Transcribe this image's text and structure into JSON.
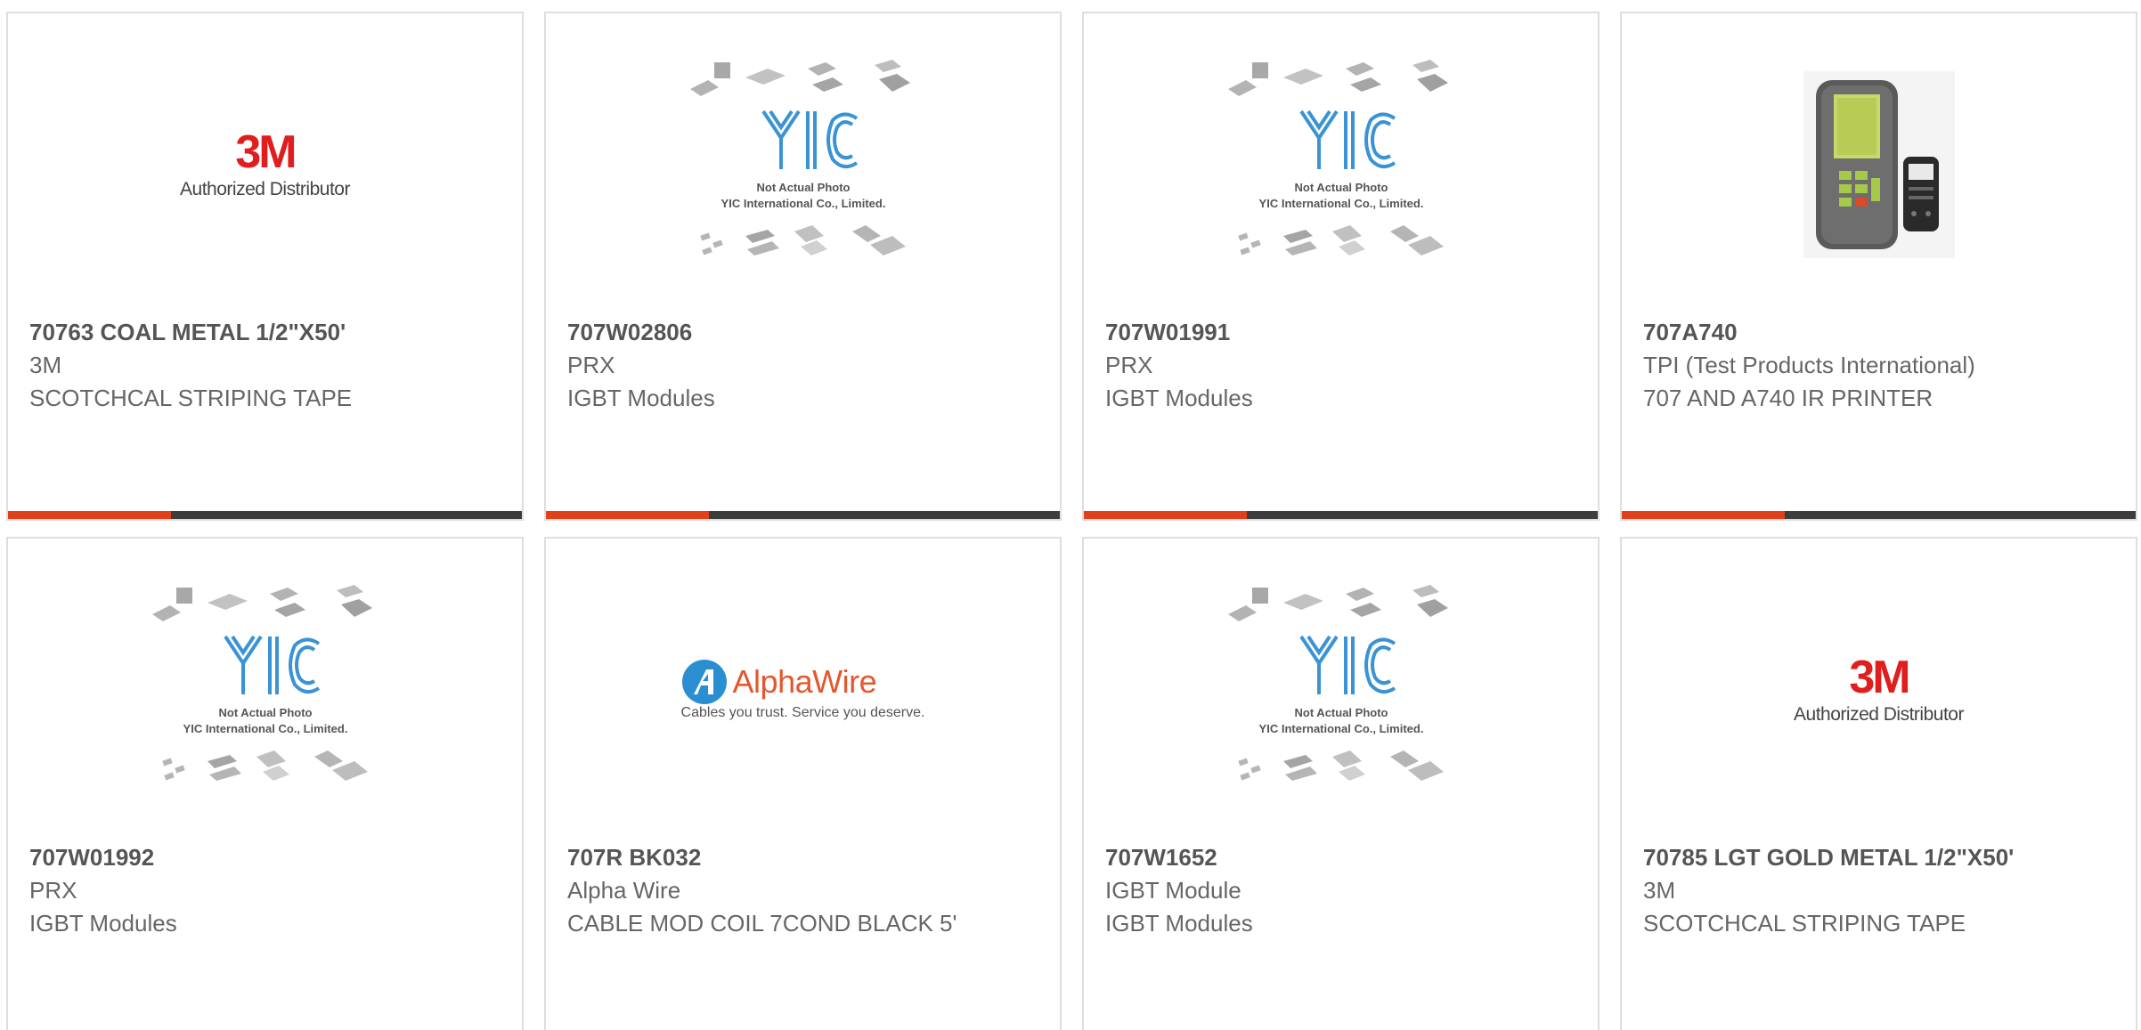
{
  "products": [
    {
      "part_number": "70763 COAL METAL 1/2\"X50'",
      "manufacturer": "3M",
      "description": "SCOTCHCAL STRIPING TAPE",
      "image": "3m-logo",
      "logo_text": "3M",
      "logo_subtext": "Authorized Distributor"
    },
    {
      "part_number": "707W02806",
      "manufacturer": "PRX",
      "description": "IGBT Modules",
      "image": "yic-placeholder",
      "placeholder_line1": "Not Actual Photo",
      "placeholder_line2": "YIC International Co., Limited."
    },
    {
      "part_number": "707W01991",
      "manufacturer": "PRX",
      "description": "IGBT Modules",
      "image": "yic-placeholder",
      "placeholder_line1": "Not Actual Photo",
      "placeholder_line2": "YIC International Co., Limited."
    },
    {
      "part_number": "707A740",
      "manufacturer": "TPI (Test Products International)",
      "description": "707 AND A740 IR PRINTER",
      "image": "analyzer-photo"
    },
    {
      "part_number": "707W01992",
      "manufacturer": "PRX",
      "description": "IGBT Modules",
      "image": "yic-placeholder",
      "placeholder_line1": "Not Actual Photo",
      "placeholder_line2": "YIC International Co., Limited."
    },
    {
      "part_number": "707R BK032",
      "manufacturer": "Alpha Wire",
      "description": "CABLE MOD COIL 7COND BLACK 5'",
      "image": "alphawire-logo",
      "logo_text": "AlphaWire",
      "logo_subtext": "Cables you trust. Service you deserve."
    },
    {
      "part_number": "707W1652",
      "manufacturer": "IGBT Module",
      "description": "IGBT Modules",
      "image": "yic-placeholder",
      "placeholder_line1": "Not Actual Photo",
      "placeholder_line2": "YIC International Co., Limited."
    },
    {
      "part_number": "70785 LGT GOLD METAL 1/2\"X50'",
      "manufacturer": "3M",
      "description": "SCOTCHCAL STRIPING TAPE",
      "image": "3m-logo",
      "logo_text": "3M",
      "logo_subtext": "Authorized Distributor"
    }
  ],
  "colors": {
    "accent": "#e0401a",
    "bar": "#3d3d3d",
    "border": "#dedede",
    "yic_blue": "#3a93d4"
  }
}
